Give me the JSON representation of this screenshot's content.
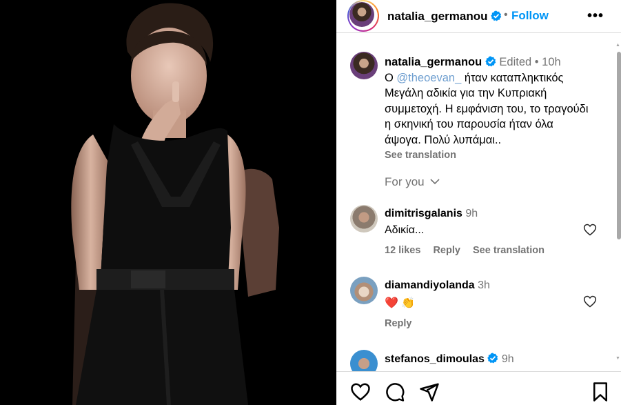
{
  "post": {
    "image_alt": "Performer on stage holding finger to lips",
    "author": "natalia_germanou",
    "follow_label": "Follow",
    "separator": "•",
    "more_label": "•••"
  },
  "caption": {
    "username": "natalia_germanou",
    "meta": "Edited • 10h",
    "prefix": "Ο ",
    "mention": "@theoevan_",
    "text": " ήταν καταπληκτικός Μεγάλη αδικία για την Κυπριακή συμμετοχή. Η εμφάνιση του, το τραγούδι η σκηνική του παρουσία ήταν όλα άψογα. Πολύ λυπάμαι..",
    "see_translation": "See translation"
  },
  "for_you": {
    "label": "For you"
  },
  "comments": [
    {
      "username": "dimitrisgalanis",
      "time": "9h",
      "text": "Αδικία...",
      "likes": "12 likes",
      "reply": "Reply",
      "see_translation": "See translation"
    },
    {
      "username": "diamandiyolanda",
      "time": "3h",
      "text": "❤️ 👏",
      "reply": "Reply"
    },
    {
      "username": "stefanos_dimoulas",
      "time": "9h"
    }
  ],
  "icons": {
    "like": "heart-icon",
    "comment": "comment-icon",
    "share": "share-icon",
    "save": "bookmark-icon",
    "verified": "verified-badge-icon"
  },
  "colors": {
    "accent": "#0095f6",
    "mention": "#6f9fd0",
    "muted": "#737373",
    "heart_red": "#e0245e",
    "clap_yellow": "#f5b31b"
  }
}
